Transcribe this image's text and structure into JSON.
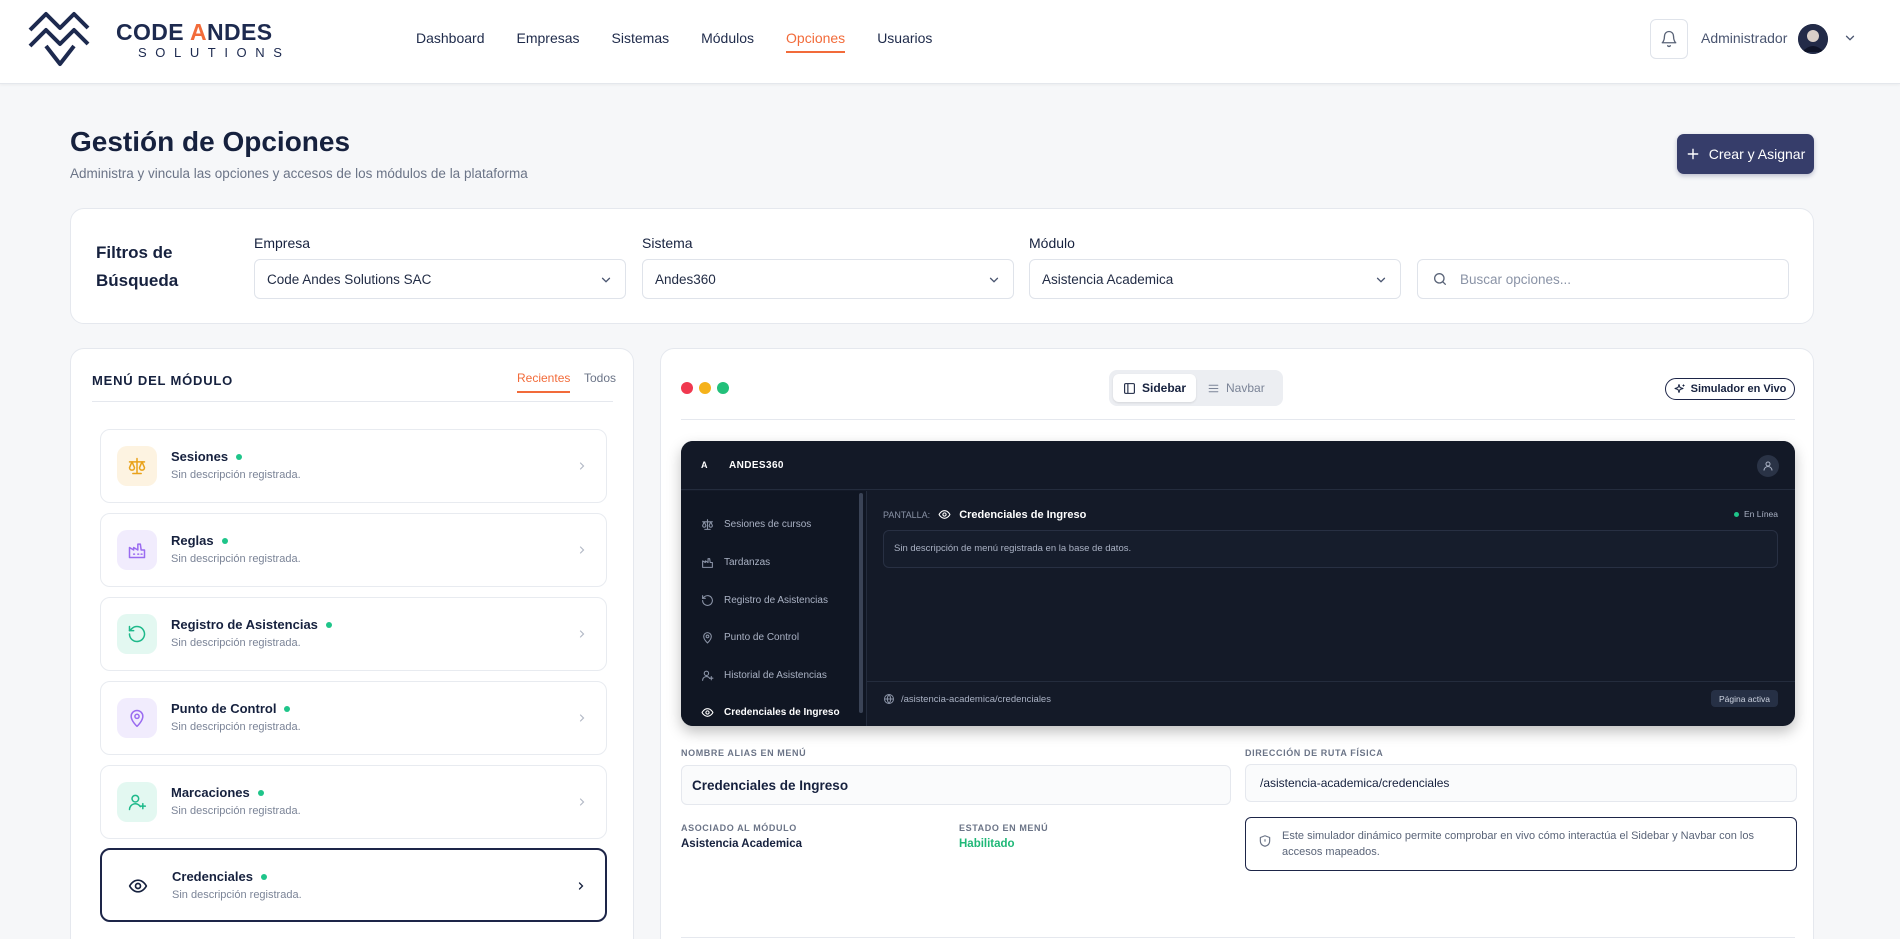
{
  "brand": {
    "line1_part1": "CODE ",
    "line1_accent": "A",
    "line1_part2": "NDES",
    "line2": "SOLUTIONS"
  },
  "nav": {
    "items": [
      {
        "label": "Dashboard"
      },
      {
        "label": "Empresas"
      },
      {
        "label": "Sistemas"
      },
      {
        "label": "Módulos"
      },
      {
        "label": "Opciones",
        "active": true
      },
      {
        "label": "Usuarios"
      }
    ]
  },
  "user": {
    "name": "Administrador"
  },
  "header": {
    "title": "Gestión de Opciones",
    "subtitle": "Administra y vincula las opciones y accesos de los módulos de la plataforma",
    "create_label": "Crear y Asignar"
  },
  "filters": {
    "title": "Filtros de Búsqueda",
    "empresa_label": "Empresa",
    "empresa_value": "Code Andes Solutions SAC",
    "sistema_label": "Sistema",
    "sistema_value": "Andes360",
    "modulo_label": "Módulo",
    "modulo_value": "Asistencia Academica",
    "search_placeholder": "Buscar opciones..."
  },
  "menu_panel": {
    "title": "MENÚ DEL MÓDULO",
    "tab_recent": "Recientes",
    "tab_all": "Todos",
    "items": [
      {
        "name": "Sesiones",
        "desc": "Sin descripción registrada.",
        "icon": "scale-icon"
      },
      {
        "name": "Reglas",
        "desc": "Sin descripción registrada.",
        "icon": "factory-icon"
      },
      {
        "name": "Registro de Asistencias",
        "desc": "Sin descripción registrada.",
        "icon": "refresh-icon"
      },
      {
        "name": "Punto de Control",
        "desc": "Sin descripción registrada.",
        "icon": "map-pin-icon"
      },
      {
        "name": "Marcaciones",
        "desc": "Sin descripción registrada.",
        "icon": "user-plus-icon"
      },
      {
        "name": "Credenciales",
        "desc": "Sin descripción registrada.",
        "icon": "eye-icon",
        "selected": true
      }
    ]
  },
  "preview_panel": {
    "toggle_sidebar": "Sidebar",
    "toggle_navbar": "Navbar",
    "simulator_label": "Simulador en Vivo",
    "app_logo": "A",
    "app_name": "ANDES360",
    "sidebar_items": [
      {
        "label": "Sesiones de cursos",
        "icon": "scale-icon"
      },
      {
        "label": "Tardanzas",
        "icon": "factory-icon"
      },
      {
        "label": "Registro de Asistencias",
        "icon": "refresh-icon"
      },
      {
        "label": "Punto de Control",
        "icon": "map-pin-icon"
      },
      {
        "label": "Historial de Asistencias",
        "icon": "user-plus-icon"
      },
      {
        "label": "Credenciales de Ingreso",
        "icon": "eye-icon",
        "active": true
      }
    ],
    "screen_label": "PANTALLA:",
    "screen_name": "Credenciales de Ingreso",
    "status": "En Línea",
    "description": "Sin descripción de menú registrada en la base de datos.",
    "path": "/asistencia-academica/credenciales",
    "page_badge": "Página activa"
  },
  "details": {
    "alias_label": "NOMBRE ALIAS EN MENÚ",
    "alias_value": "Credenciales de Ingreso",
    "route_label": "DIRECCIÓN DE RUTA FÍSICA",
    "route_value": "/asistencia-academica/credenciales",
    "module_label": "ASOCIADO AL MÓDULO",
    "module_value": "Asistencia Academica",
    "state_label": "ESTADO EN MENÚ",
    "state_value": "Habilitado",
    "info_text": "Este simulador dinámico permite comprobar en vivo cómo interactúa el Sidebar y Navbar con los accesos mapeados."
  },
  "colors": {
    "accent": "#f26b3a",
    "primary": "#363d6a",
    "online": "#1fc58a",
    "window_red": "#f0384f",
    "window_yellow": "#f5b21b",
    "window_green": "#22c07a"
  }
}
